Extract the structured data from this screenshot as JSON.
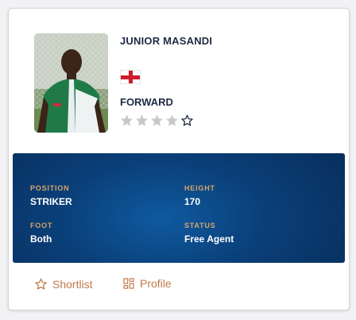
{
  "player": {
    "name": "JUNIOR MASANDI",
    "nationality_flag": "england-flag",
    "position_title": "FORWARD",
    "rating": 4,
    "rating_max": 5
  },
  "stats": {
    "position": {
      "label": "POSITION",
      "value": "STRIKER"
    },
    "height": {
      "label": "HEIGHT",
      "value": "170"
    },
    "foot": {
      "label": "FOOT",
      "value": "Both"
    },
    "status": {
      "label": "STATUS",
      "value": "Free Agent"
    }
  },
  "actions": {
    "shortlist": {
      "label": "Shortlist",
      "icon": "star-outline-icon"
    },
    "profile": {
      "label": "Profile",
      "icon": "grid-icon"
    }
  },
  "colors": {
    "accent": "#c07a4a",
    "panel": "#0a3f78",
    "text_dark": "#1f2a44"
  }
}
